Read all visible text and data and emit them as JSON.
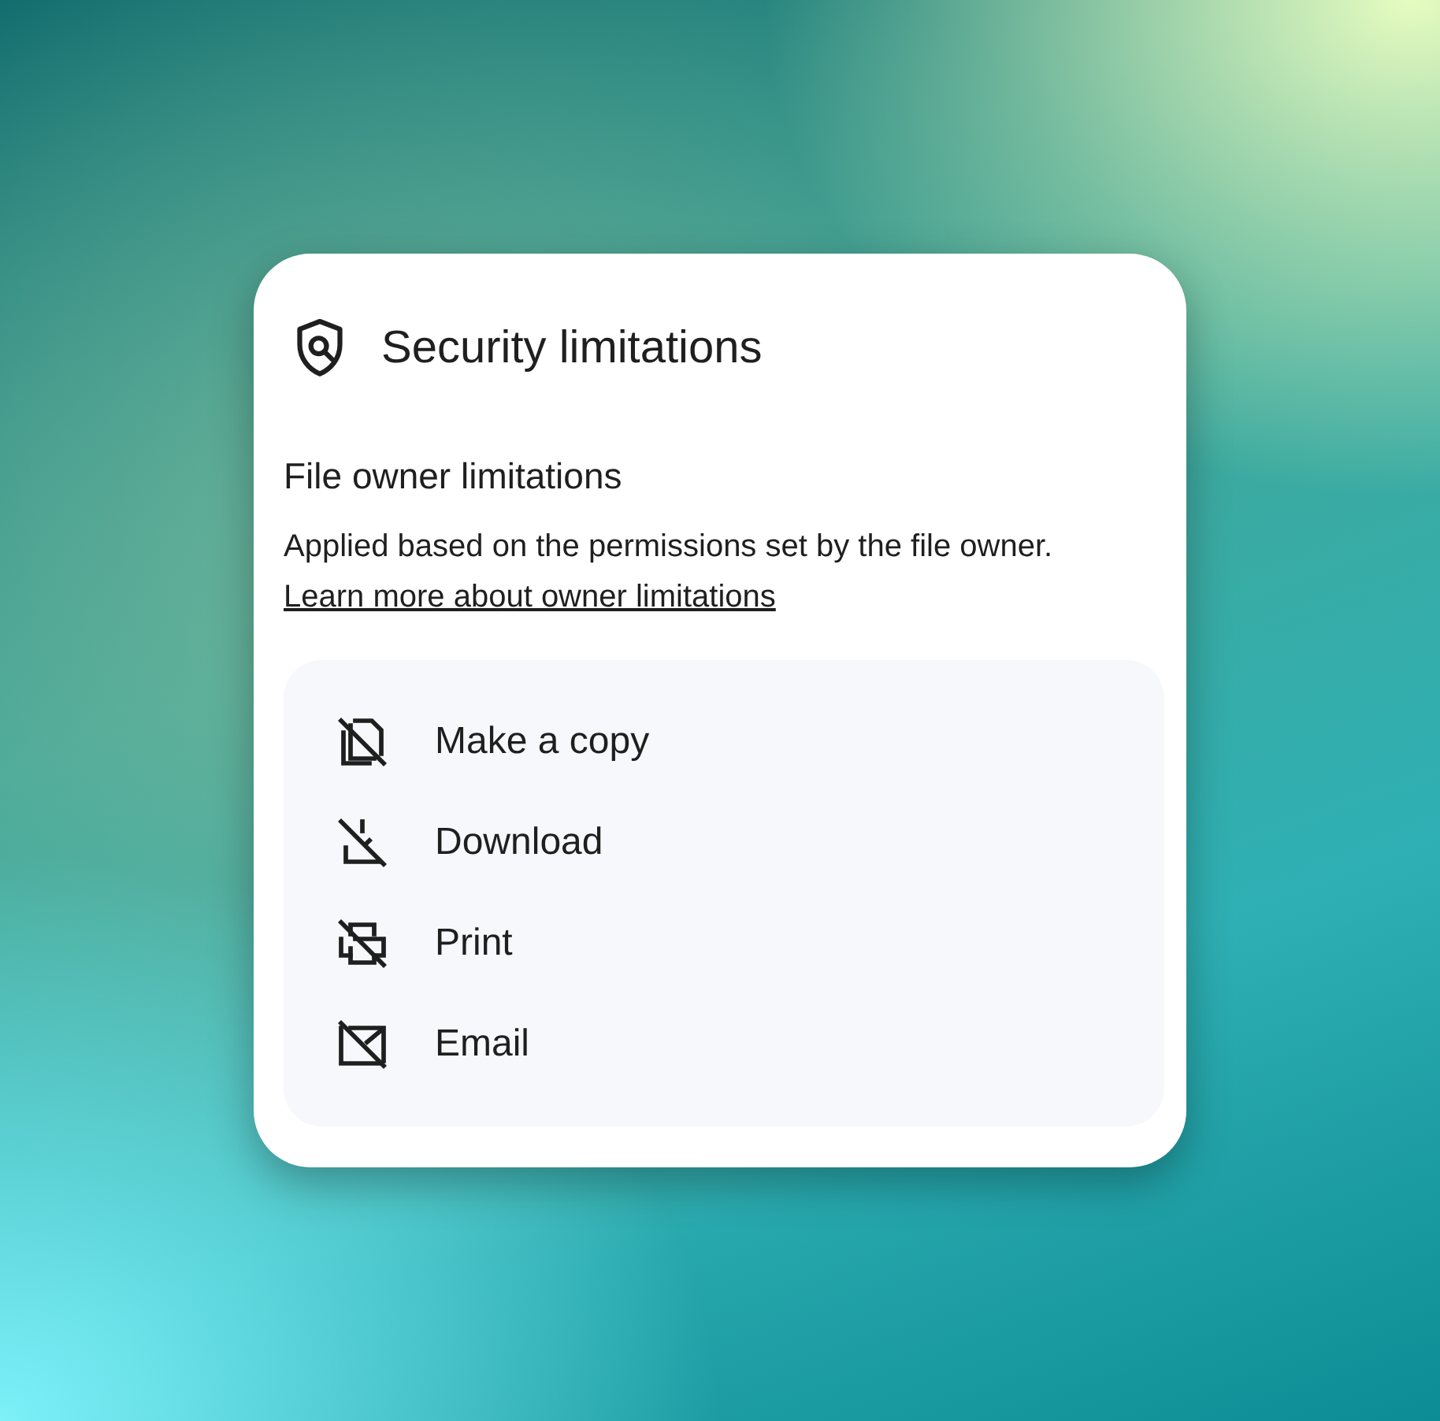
{
  "dialog": {
    "title": "Security limitations",
    "section": {
      "heading": "File owner limitations",
      "description": "Applied based on the permissions set by the file owner.",
      "link": "Learn more about owner limitations"
    },
    "limitations": [
      {
        "kind": "copy",
        "label": "Make a copy"
      },
      {
        "kind": "download",
        "label": "Download"
      },
      {
        "kind": "print",
        "label": "Print"
      },
      {
        "kind": "email",
        "label": "Email"
      }
    ]
  }
}
